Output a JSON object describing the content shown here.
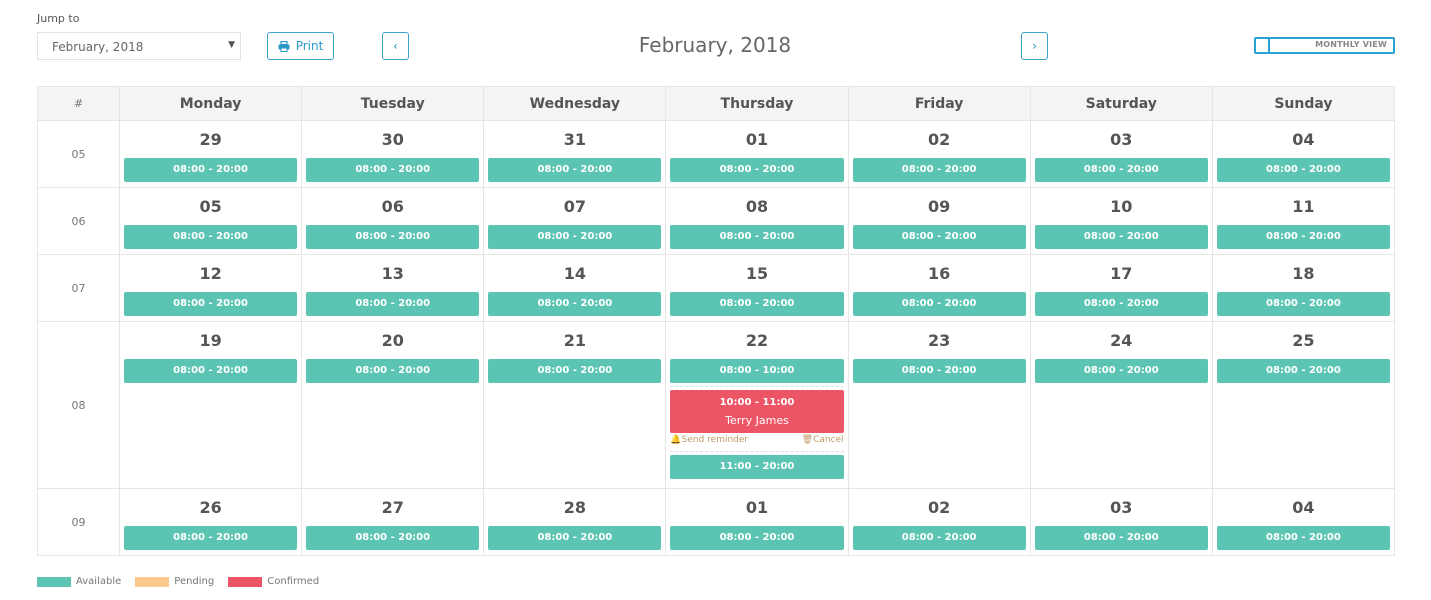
{
  "toolbar": {
    "jump_label": "Jump to",
    "jump_value": "February, 2018",
    "print_label": "Print",
    "prev_label": "‹",
    "next_label": "›",
    "month_title": "February, 2018",
    "view_toggle_label": "MONTHLY VIEW"
  },
  "colors": {
    "available": "#5bc4b3",
    "pending": "#fbc98e",
    "confirmed": "#ec5566",
    "accent": "#2a98c4"
  },
  "calendar": {
    "week_header": "#",
    "days": [
      "Monday",
      "Tuesday",
      "Wednesday",
      "Thursday",
      "Friday",
      "Saturday",
      "Sunday"
    ],
    "weeks": [
      {
        "week": "05",
        "dates": [
          "29",
          "30",
          "31",
          "01",
          "02",
          "03",
          "04"
        ]
      },
      {
        "week": "06",
        "dates": [
          "05",
          "06",
          "07",
          "08",
          "09",
          "10",
          "11"
        ]
      },
      {
        "week": "07",
        "dates": [
          "12",
          "13",
          "14",
          "15",
          "16",
          "17",
          "18"
        ]
      },
      {
        "week": "08",
        "dates": [
          "19",
          "20",
          "21",
          "22",
          "23",
          "24",
          "25"
        ]
      },
      {
        "week": "09",
        "dates": [
          "26",
          "27",
          "28",
          "01",
          "02",
          "03",
          "04"
        ]
      }
    ],
    "default_slot": "08:00 - 20:00",
    "special_day": {
      "week_index": 3,
      "day_index": 3,
      "slots": [
        {
          "type": "available",
          "time": "08:00 - 10:00"
        },
        {
          "type": "confirmed",
          "time": "10:00 - 11:00",
          "name": "Terry James",
          "actions": {
            "reminder": "Send reminder",
            "cancel": "Cancel"
          }
        },
        {
          "type": "available",
          "time": "11:00 - 20:00"
        }
      ]
    }
  },
  "legend": [
    {
      "label": "Available",
      "color": "#5bc4b3"
    },
    {
      "label": "Pending",
      "color": "#fbc98e"
    },
    {
      "label": "Confirmed",
      "color": "#ec5566"
    }
  ]
}
